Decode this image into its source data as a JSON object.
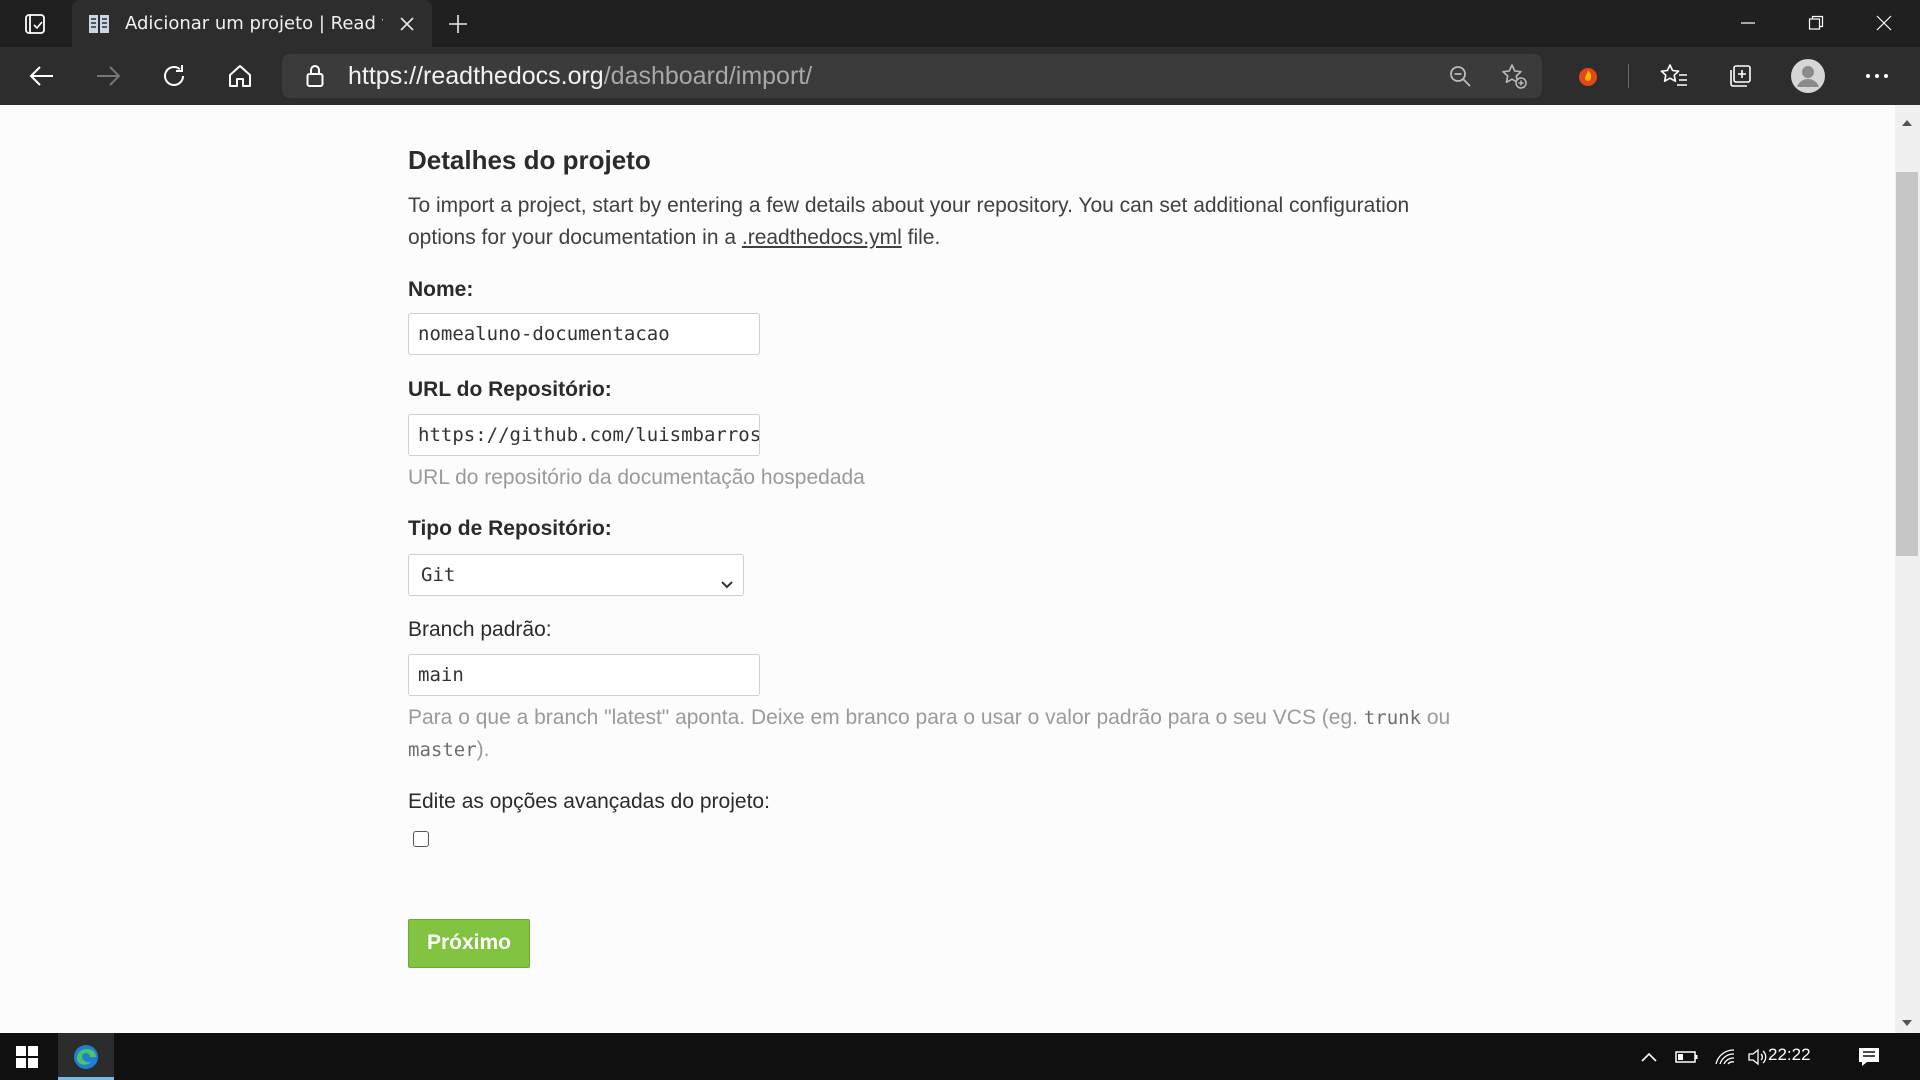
{
  "browser": {
    "tab": {
      "title": "Adicionar um projeto | Read the Docs"
    },
    "address": {
      "host": "https://readthedocs.org",
      "path": "/dashboard/import/"
    }
  },
  "page": {
    "heading": "Detalhes do projeto",
    "intro_before": "To import a project, start by entering a few details about your repository. You can set additional configuration options for your documentation in a ",
    "intro_link": ".readthedocs.yml",
    "intro_after": " file.",
    "name_field": {
      "label": "Nome:",
      "value": "nomealuno-documentacao"
    },
    "repo_url_field": {
      "label": "URL do Repositório:",
      "value": "https://github.com/luismbarros",
      "help": "URL do repositório da documentação hospedada"
    },
    "repo_type_field": {
      "label": "Tipo de Repositório:",
      "selected": "Git"
    },
    "branch_field": {
      "label": "Branch padrão:",
      "value": "main",
      "help_before": "Para o que a branch \"latest\" aponta. Deixe em branco para o usar o valor padrão para o seu VCS (eg. ",
      "help_code1": "trunk",
      "help_mid": " ou ",
      "help_code2": "master",
      "help_after": ")."
    },
    "advanced_field": {
      "label": "Edite as opções avançadas do projeto:",
      "checked": false
    },
    "next_button": "Próximo"
  },
  "taskbar": {
    "clock": "22:22"
  },
  "colors": {
    "button_green": "#82c341",
    "titlebar": "#202020",
    "toolbar": "#2d2d2e"
  },
  "icons": [
    "tab-actions-icon",
    "docs-favicon-icon",
    "close-icon",
    "plus-icon",
    "minimize-icon",
    "restore-icon",
    "back-icon",
    "forward-icon",
    "refresh-icon",
    "home-icon",
    "lock-icon",
    "zoom-out-icon",
    "add-favorite-icon",
    "extension-icon",
    "favorites-icon",
    "collections-icon",
    "profile-icon",
    "more-icon",
    "windows-start-icon",
    "edge-icon",
    "chevron-up-icon",
    "battery-icon",
    "wifi-icon",
    "volume-icon",
    "notification-icon"
  ]
}
